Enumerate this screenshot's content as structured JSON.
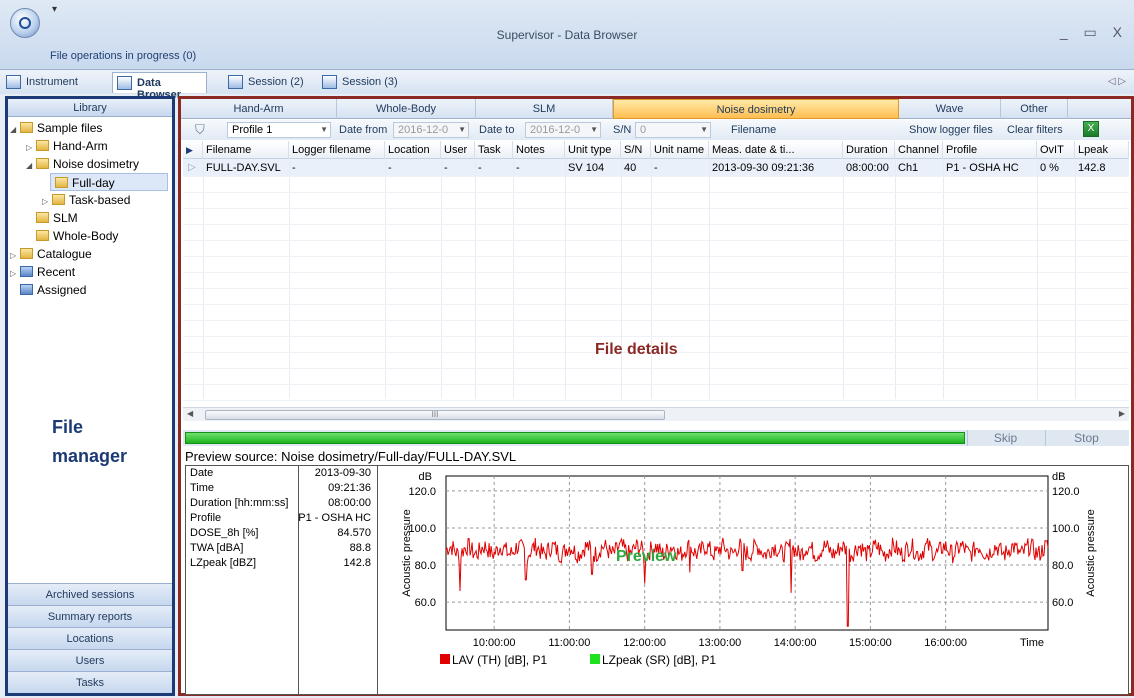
{
  "window": {
    "title": "Supervisor - Data Browser",
    "file_ops": "File operations in progress (0)",
    "controls": "_ ▭ X",
    "tab_arrows": "◁ ▷"
  },
  "app_tabs": [
    {
      "label": "Instrument",
      "icon": "instrument-icon"
    },
    {
      "label": "Data Browser",
      "icon": "data-browser-icon"
    },
    {
      "label": "Session (2)",
      "icon": "session-icon"
    },
    {
      "label": "Session (3)",
      "icon": "session-icon"
    }
  ],
  "library": {
    "header": "Library",
    "tree": [
      {
        "label": "Sample files",
        "level": 0,
        "expanded": true
      },
      {
        "label": "Hand-Arm",
        "level": 1,
        "expanded": false
      },
      {
        "label": "Noise dosimetry",
        "level": 1,
        "expanded": true
      },
      {
        "label": "Full-day",
        "level": 2,
        "selected": true
      },
      {
        "label": "Task-based",
        "level": 2,
        "expanded": false
      },
      {
        "label": "SLM",
        "level": 1
      },
      {
        "label": "Whole-Body",
        "level": 1
      },
      {
        "label": "Catalogue",
        "level": 0,
        "expanded": false
      },
      {
        "label": "Recent",
        "level": 0,
        "expanded": false
      },
      {
        "label": "Assigned",
        "level": 0
      }
    ],
    "annotation_line1": "File",
    "annotation_line2": "manager",
    "buttons": [
      "Archived sessions",
      "Summary reports",
      "Locations",
      "Users",
      "Tasks"
    ]
  },
  "category_tabs": [
    "Hand-Arm",
    "Whole-Body",
    "SLM",
    "Noise dosimetry",
    "Wave",
    "Other"
  ],
  "active_category": "Noise dosimetry",
  "filter": {
    "profile": "Profile 1",
    "date_from_label": "Date from",
    "date_from": "2016-12-0",
    "date_to_label": "Date to",
    "date_to": "2016-12-0",
    "sn_label": "S/N",
    "sn": "0",
    "filename_placeholder": "Filename",
    "show_logger": "Show logger files",
    "clear_filters": "Clear filters"
  },
  "grid": {
    "columns": [
      "Filename",
      "Logger filename",
      "Location",
      "User",
      "Task",
      "Notes",
      "Unit type",
      "S/N",
      "Unit name",
      "Meas. date & ti...",
      "Duration",
      "Channel",
      "Profile",
      "OvIT",
      "Lpeak"
    ],
    "rows": [
      [
        "FULL-DAY.SVL",
        "-",
        "-",
        "-",
        "-",
        "-",
        "SV 104",
        "40",
        "-",
        "2013-09-30 09:21:36",
        "08:00:00",
        "Ch1",
        "P1 - OSHA HC",
        "0 %",
        "142.8"
      ]
    ],
    "annotation": "File details",
    "scroll_thumb": "III"
  },
  "progress": {
    "fraction": 0.83,
    "skip": "Skip",
    "stop": "Stop"
  },
  "preview": {
    "source": "Preview source: Noise dosimetry/Full-day/FULL-DAY.SVL",
    "params": [
      {
        "k": "Date",
        "v": "2013-09-30"
      },
      {
        "k": "Time",
        "v": "09:21:36"
      },
      {
        "k": "Duration [hh:mm:ss]",
        "v": "08:00:00"
      },
      {
        "k": "Profile",
        "v": "P1 - OSHA HC"
      },
      {
        "k": "DOSE_8h [%]",
        "v": "84.570"
      },
      {
        "k": "TWA [dBA]",
        "v": "88.8"
      },
      {
        "k": "LZpeak [dBZ]",
        "v": "142.8"
      }
    ],
    "annotation": "Preview"
  },
  "chart_data": {
    "type": "line",
    "yunit": "dB",
    "ylabel": "Acoustic pressure",
    "xlabel": "Time",
    "ylim": [
      45,
      128
    ],
    "yticks": [
      "60.0",
      "80.0",
      "100.0",
      "120.0"
    ],
    "xticks": [
      "10:00:00",
      "11:00:00",
      "12:00:00",
      "13:00:00",
      "14:00:00",
      "15:00:00",
      "16:00:00"
    ],
    "series": [
      {
        "name": "LAV (TH) [dB], P1",
        "color": "#e00000",
        "x_start_hours": 9.36,
        "x_end_hours": 17.36,
        "baseline": 88,
        "dips": [
          {
            "t": 9.55,
            "v": 66
          },
          {
            "t": 10.42,
            "v": 72
          },
          {
            "t": 11.3,
            "v": 75
          },
          {
            "t": 12.0,
            "v": 70
          },
          {
            "t": 12.6,
            "v": 76
          },
          {
            "t": 13.3,
            "v": 77
          },
          {
            "t": 13.95,
            "v": 65
          },
          {
            "t": 14.7,
            "v": 47
          }
        ]
      },
      {
        "name": "LZpeak (SR) [dB], P1",
        "color": "#1fe21f"
      }
    ]
  }
}
